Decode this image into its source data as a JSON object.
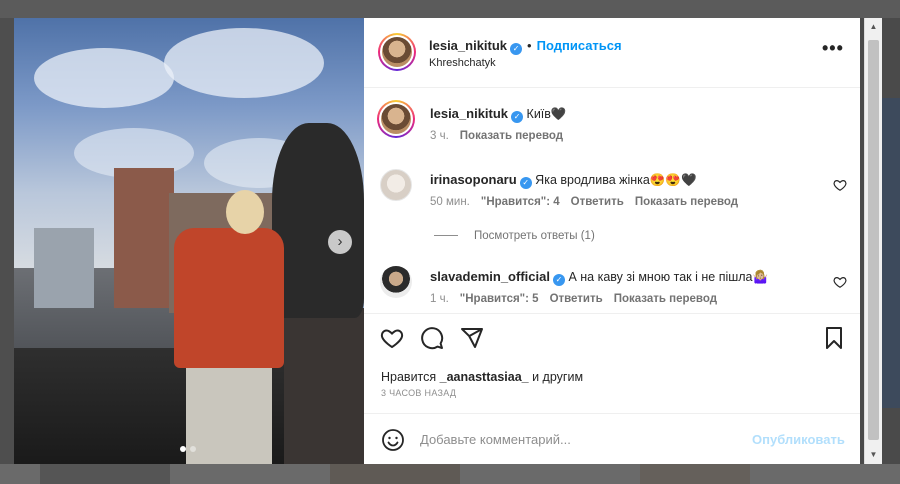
{
  "post": {
    "author": {
      "username": "lesia_nikituk",
      "follow_label": "Подписаться",
      "separator": "•",
      "location": "Khreshchatyk"
    },
    "caption": {
      "username": "lesia_nikituk",
      "text": "Київ🖤",
      "time": "3 ч.",
      "translate_label": "Показать перевод"
    },
    "comments": [
      {
        "username": "irinasoponaru",
        "text": "Яка вродлива жінка😍😍🖤",
        "time": "50 мин.",
        "likes": "\"Нравится\": 4",
        "reply_label": "Ответить",
        "translate_label": "Показать перевод"
      },
      {
        "username": "slavademin_official",
        "text": "А на каву зі мною так і не пішла🤷🏼‍♀️",
        "time": "1 ч.",
        "likes": "\"Нравится\": 5",
        "reply_label": "Ответить",
        "translate_label": "Показать перевод"
      }
    ],
    "view_replies_label": "Посмотреть ответы (1)",
    "likes_prefix": "Нравится",
    "likes_user": "_aanasttasiaa_",
    "likes_suffix": "и другим",
    "posted_ago": "3 ЧАСОВ НАЗАД",
    "add_comment_placeholder": "Добавьте комментарий...",
    "publish_label": "Опубликовать",
    "carousel": {
      "current_slide": 1,
      "total_slides": 2
    }
  },
  "colors": {
    "link_blue": "#0095f6",
    "publish_disabled": "#b2dffc",
    "verified_blue": "#3897f0",
    "muted_text": "#8e8e8e"
  },
  "icons": {
    "verified": "verified-badge-icon",
    "more": "more-options-icon",
    "next": "chevron-right-icon",
    "like": "heart-icon",
    "comment": "comment-icon",
    "share": "paper-plane-icon",
    "save": "bookmark-icon",
    "emoji": "emoji-icon"
  }
}
